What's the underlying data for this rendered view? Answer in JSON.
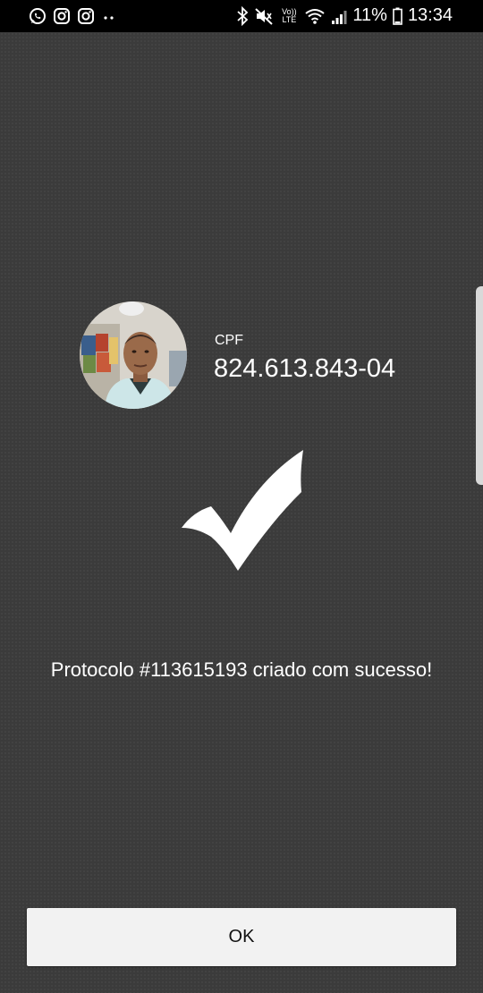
{
  "status_bar": {
    "left_icons": [
      "whatsapp-icon",
      "instagram-icon",
      "instagram-icon",
      "more-notifications-icon"
    ],
    "volte_line1": "Vo))",
    "volte_line2": "LTE",
    "battery": "11%",
    "time": "13:34"
  },
  "profile": {
    "cpf_label": "CPF",
    "cpf_value": "824.613.843-04"
  },
  "result": {
    "icon": "checkmark-icon",
    "message": "Protocolo #113615193 criado com sucesso!"
  },
  "actions": {
    "ok_label": "OK"
  },
  "colors": {
    "background": "#3b3b3b",
    "button": "#f2f2f2",
    "status_bar": "#000000"
  }
}
